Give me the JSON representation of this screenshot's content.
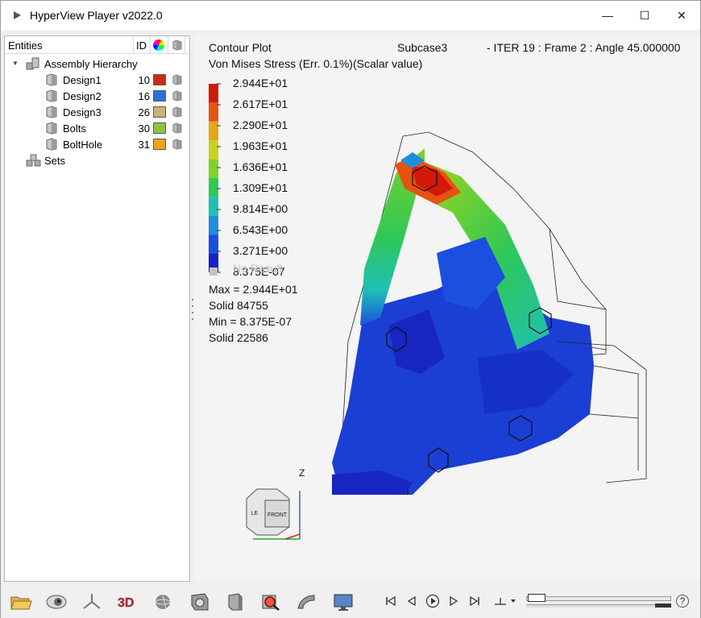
{
  "window": {
    "title": "HyperView Player v2022.0",
    "minimize_glyph": "—",
    "maximize_glyph": "☐",
    "close_glyph": "✕"
  },
  "entities_panel": {
    "header_entities": "Entities",
    "header_id": "ID",
    "assembly_label": "Assembly Hierarchy",
    "sets_label": "Sets",
    "parts": [
      {
        "name": "Design1",
        "id": "10",
        "color": "#c62b1e"
      },
      {
        "name": "Design2",
        "id": "16",
        "color": "#2f6fd6"
      },
      {
        "name": "Design3",
        "id": "26",
        "color": "#c9b479"
      },
      {
        "name": "Bolts",
        "id": "30",
        "color": "#8fc43d"
      },
      {
        "name": "BoltHole",
        "id": "31",
        "color": "#f0a21f"
      }
    ]
  },
  "viewport": {
    "plot_type": "Contour Plot",
    "subcase": "Subcase3",
    "frame_info": "- ITER 19 : Frame 2 : Angle 45.000000",
    "result_label": "Von Mises Stress (Err. 0.1%)(Scalar value)",
    "legend_values": [
      "2.944E+01",
      "2.617E+01",
      "2.290E+01",
      "1.963E+01",
      "1.636E+01",
      "1.309E+01",
      "9.814E+00",
      "6.543E+00",
      "3.271E+00",
      "8.375E-07"
    ],
    "legend_colors": [
      "#d21a0a",
      "#e55312",
      "#e7a51a",
      "#c8d21e",
      "#7fd12b",
      "#2fc856",
      "#1ec0b6",
      "#1c8fe0",
      "#1b4fe0",
      "#1522c8"
    ],
    "no_result_label": "No Result",
    "no_result_color": "#c4c4c4",
    "max_line": "Max = 2.944E+01",
    "max_solid": "Solid 84755",
    "min_line": "Min = 8.375E-07",
    "min_solid": "Solid 22586",
    "triad_axis": "Z",
    "cube_front": "FRONT",
    "cube_left": "LE"
  },
  "toolbar": {
    "tools": [
      "open-folder-icon",
      "eye-icon",
      "axes-icon",
      "3d-icon",
      "sphere-icon",
      "model-icon",
      "cube-icon",
      "zoom-icon",
      "section-icon",
      "display-icon"
    ],
    "playback": [
      "first-frame-icon",
      "previous-frame-icon",
      "play-icon",
      "next-frame-icon",
      "last-frame-icon",
      "animation-mode-icon"
    ],
    "help_glyph": "?"
  }
}
